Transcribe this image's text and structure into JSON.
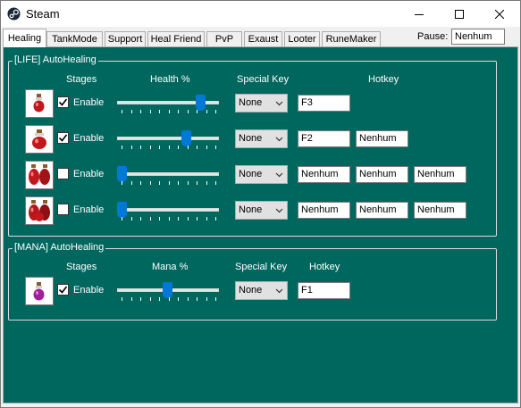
{
  "window": {
    "title": "Steam",
    "app_icon": "steam-icon"
  },
  "tabs": [
    {
      "label": "Healing",
      "active": true
    },
    {
      "label": "TankMode"
    },
    {
      "label": "Support"
    },
    {
      "label": "Heal Friend"
    },
    {
      "label": "PvP"
    },
    {
      "label": "Exaust"
    },
    {
      "label": "Looter"
    },
    {
      "label": "RuneMaker"
    }
  ],
  "pause": {
    "label": "Pause:",
    "value": "Nenhum"
  },
  "life": {
    "title": "[LIFE] AutoHealing",
    "headers": {
      "stages": "Stages",
      "health": "Health %",
      "special_key": "Special Key",
      "hotkey": "Hotkey"
    },
    "rows": [
      {
        "potion_icon": "small-health-potion-icon",
        "enabled": true,
        "enable_label": "Enable",
        "slider_level": 0.82,
        "special_key": "None",
        "hotkeys": [
          "F3"
        ]
      },
      {
        "potion_icon": "health-potion-icon",
        "enabled": true,
        "enable_label": "Enable",
        "slider_level": 0.66,
        "special_key": "None",
        "hotkeys": [
          "F2",
          "Nenhum"
        ]
      },
      {
        "potion_icon": "strong-health-potion-icon",
        "enabled": false,
        "enable_label": "Enable",
        "slider_level": 0.0,
        "special_key": "None",
        "hotkeys": [
          "Nenhum",
          "Nenhum",
          "Nenhum"
        ]
      },
      {
        "potion_icon": "great-health-potion-icon",
        "enabled": false,
        "enable_label": "Enable",
        "slider_level": 0.0,
        "special_key": "None",
        "hotkeys": [
          "Nenhum",
          "Nenhum",
          "Nenhum"
        ]
      }
    ]
  },
  "mana": {
    "title": "[MANA] AutoHealing",
    "headers": {
      "stages": "Stages",
      "mana": "Mana %",
      "special_key": "Special Key",
      "hotkey": "Hotkey"
    },
    "rows": [
      {
        "potion_icon": "mana-potion-icon",
        "enabled": true,
        "enable_label": "Enable",
        "slider_level": 0.47,
        "special_key": "None",
        "hotkeys": [
          "F1"
        ]
      }
    ]
  },
  "colors": {
    "panel": "#00675f",
    "slider_thumb": "#0078d7",
    "life_potion": "#c0181c",
    "mana_potion": "#a0209a"
  }
}
